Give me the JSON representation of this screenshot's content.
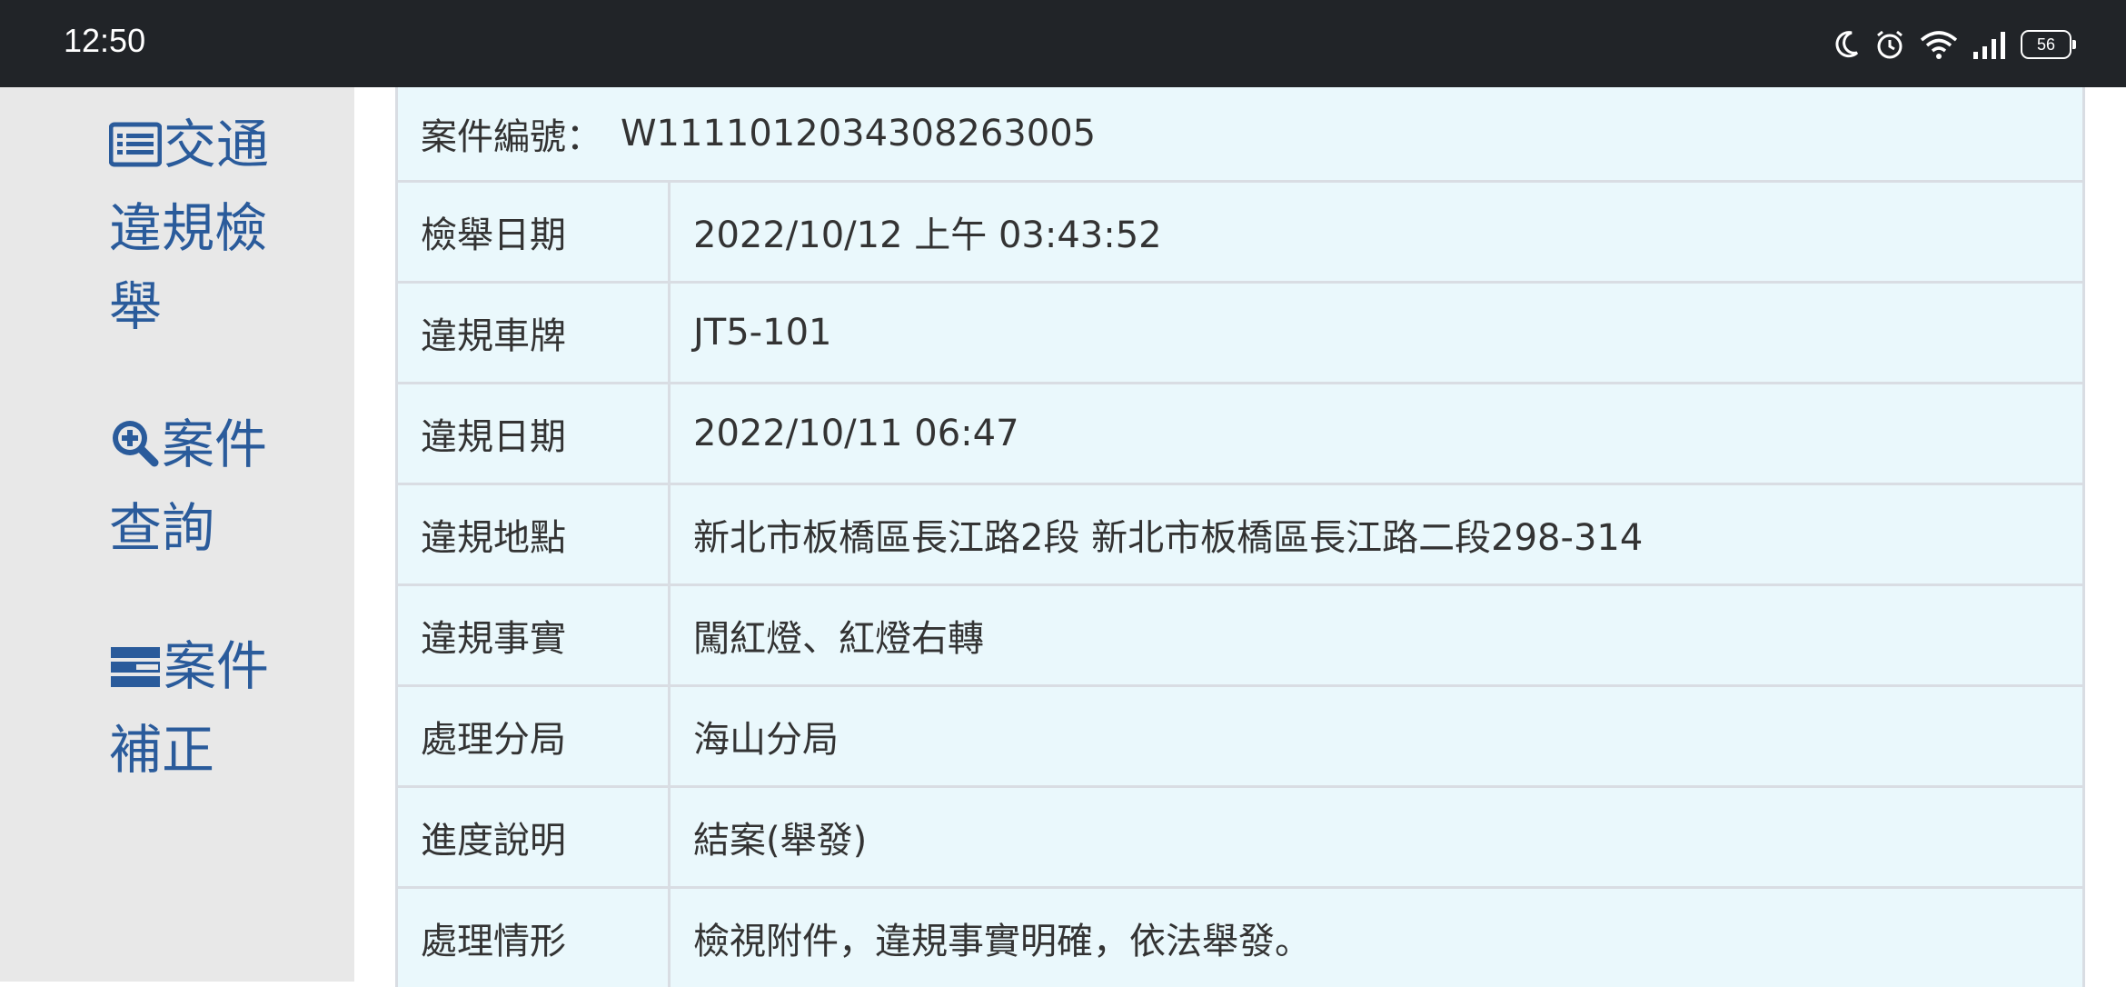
{
  "status_bar": {
    "time": "12:50",
    "battery": "56",
    "icons": [
      "moon-icon",
      "alarm-icon",
      "wifi-icon",
      "signal-icon",
      "battery-icon"
    ]
  },
  "sidebar": {
    "accent_color": "#2a5b9b",
    "items": [
      {
        "icon": "list-icon",
        "lines": [
          "交通",
          "違規檢",
          "舉"
        ]
      },
      {
        "icon": "search-plus-icon",
        "lines": [
          "案件",
          "查詢"
        ]
      },
      {
        "icon": "form-icon",
        "lines": [
          "案件",
          "補正"
        ]
      }
    ]
  },
  "case": {
    "number_label": "案件編號：",
    "number_value": "W1111012034308263005"
  },
  "rows": [
    {
      "label": "檢舉日期",
      "value": "2022/10/12 上午 03:43:52"
    },
    {
      "label": "違規車牌",
      "value": "JT5-101"
    },
    {
      "label": "違規日期",
      "value": "2022/10/11 06:47"
    },
    {
      "label": "違規地點",
      "value": "新北市板橋區長江路2段 新北市板橋區長江路二段298-314"
    },
    {
      "label": "違規事實",
      "value": "闖紅燈、紅燈右轉"
    },
    {
      "label": "處理分局",
      "value": "海山分局"
    },
    {
      "label": "進度說明",
      "value": "結案(舉發)"
    },
    {
      "label": "處理情形",
      "value": "檢視附件，違規事實明確，依法舉發。"
    }
  ]
}
